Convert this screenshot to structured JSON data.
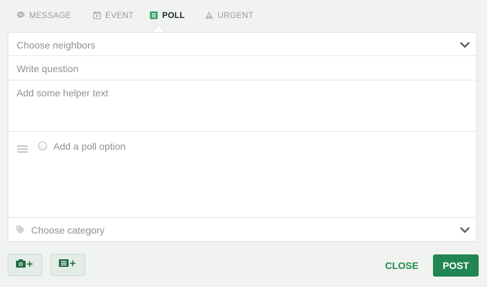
{
  "tabs": [
    {
      "label": "MESSAGE",
      "icon": "speech-bubble-icon",
      "active": false
    },
    {
      "label": "EVENT",
      "icon": "calendar-icon",
      "active": false
    },
    {
      "label": "POLL",
      "icon": "poll-list-icon",
      "active": true
    },
    {
      "label": "URGENT",
      "icon": "warning-icon",
      "active": false
    }
  ],
  "form": {
    "neighbors_placeholder": "Choose neighbors",
    "question_placeholder": "Write  question",
    "helper_placeholder": "Add some helper text",
    "poll_option_placeholder": "Add a poll option",
    "category_placeholder": "Choose category"
  },
  "actions": {
    "close_label": "CLOSE",
    "post_label": "POST"
  },
  "colors": {
    "accent": "#218654",
    "active_tab_icon": "#2a9d5f",
    "muted_text": "#8f928e",
    "background": "#f1f3f0"
  }
}
